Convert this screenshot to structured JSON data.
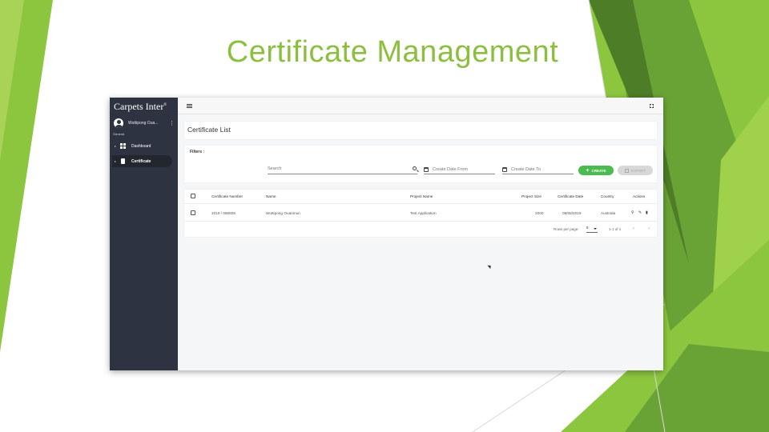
{
  "slide": {
    "title": "Certificate Management",
    "colors": {
      "title": "#8cbf3f",
      "green_dark": "#5c8f2e",
      "green_mid": "#7fb63c",
      "green_light": "#a8d356"
    }
  },
  "app": {
    "logo": "Carpets Inter",
    "logo_mark": "®",
    "user": {
      "name": "Wuttipong Oua...",
      "menu_icon": "kebab-icon",
      "avatar_icon": "user-avatar-icon"
    },
    "nav_section": "General",
    "nav": [
      {
        "label": "Dashboard",
        "icon": "dashboard-icon",
        "active": false
      },
      {
        "label": "Certificate",
        "icon": "document-icon",
        "active": true
      }
    ],
    "topbar": {
      "menu_icon": "hamburger-icon",
      "fullscreen_icon": "fullscreen-icon"
    },
    "page_title": "Certificate List",
    "filters": {
      "label": "Filters :",
      "search_placeholder": "Search",
      "date_from": "Create Date From",
      "date_to": "Create Date To",
      "create_label": "CREATE",
      "export_label": "EXPORT"
    },
    "table": {
      "headers": [
        "Certificate Number",
        "Name",
        "Project Name",
        "Project Size",
        "Certificate Date",
        "Country",
        "Actions"
      ],
      "rows": [
        {
          "certificate_number": "2019 / 080805",
          "name": "Wuttipong Ouanmun",
          "project_name": "Test Application",
          "project_size": "2000",
          "certificate_date": "08/08/2019",
          "country": "Australia",
          "actions": [
            "search-icon",
            "edit-icon",
            "delete-icon"
          ]
        }
      ]
    },
    "pagination": {
      "rows_label": "Rows per page:",
      "rows_value": "5",
      "range": "1-1 of 1"
    },
    "accent": "#4cbb4f",
    "sidebar_color": "#2d3340"
  }
}
